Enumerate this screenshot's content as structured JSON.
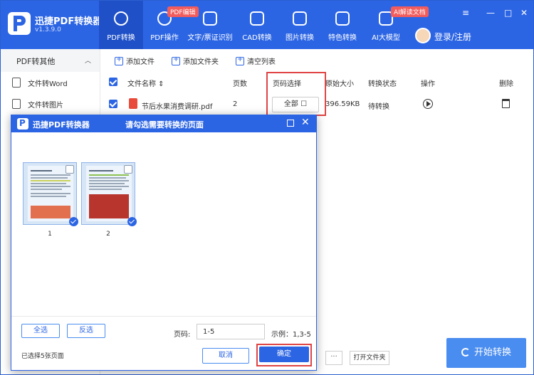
{
  "app": {
    "name": "迅捷PDF转换器",
    "version": "v1.3.9.0"
  },
  "nav": {
    "items": [
      {
        "label": "PDF转换",
        "active": true
      },
      {
        "label": "PDF操作",
        "badge": "PDF编辑"
      },
      {
        "label": "文字/票证识别"
      },
      {
        "label": "CAD转换"
      },
      {
        "label": "图片转换"
      },
      {
        "label": "特色转换"
      },
      {
        "label": "AI大模型",
        "badge": "AI解读文档"
      }
    ],
    "login_label": "登录/注册"
  },
  "window_controls": {
    "menu": "≡",
    "minimize": "—",
    "maximize": "□",
    "close": "✕"
  },
  "sidebar": {
    "header": "PDF转其他",
    "chevron": "︿",
    "items": [
      {
        "label": "文件转Word"
      },
      {
        "label": "文件转图片"
      }
    ]
  },
  "toolbar": {
    "add_file": "添加文件",
    "add_folder": "添加文件夹",
    "clear_list": "清空列表"
  },
  "table": {
    "headers": {
      "filename": "文件名称 ⇕",
      "pages": "页数",
      "page_select": "页码选择",
      "size": "原始大小",
      "status": "转换状态",
      "action": "操作",
      "delete": "删除"
    },
    "rows": [
      {
        "filename": "节后水果消费调研.pdf",
        "pages": "2",
        "page_select": "全部 ☐",
        "size": "396.59KB",
        "status": "待转换"
      }
    ]
  },
  "bottom": {
    "dots": "···",
    "open_folder": "打开文件夹",
    "start": "开始转换"
  },
  "dialog": {
    "app_name": "迅捷PDF转换器",
    "title": "请勾选需要转换的页面",
    "thumbnails": [
      {
        "number": "1",
        "checked": true
      },
      {
        "number": "2",
        "checked": true
      }
    ],
    "select_all": "全选",
    "invert": "反选",
    "page_label": "页码:",
    "page_value": "1-5",
    "example": "示例：1,3-5",
    "selected_info": "已选择5张页面",
    "cancel": "取消",
    "confirm": "确定"
  },
  "colors": {
    "primary": "#2c65e4",
    "highlight": "#e04444",
    "badge": "#f25c5c"
  }
}
